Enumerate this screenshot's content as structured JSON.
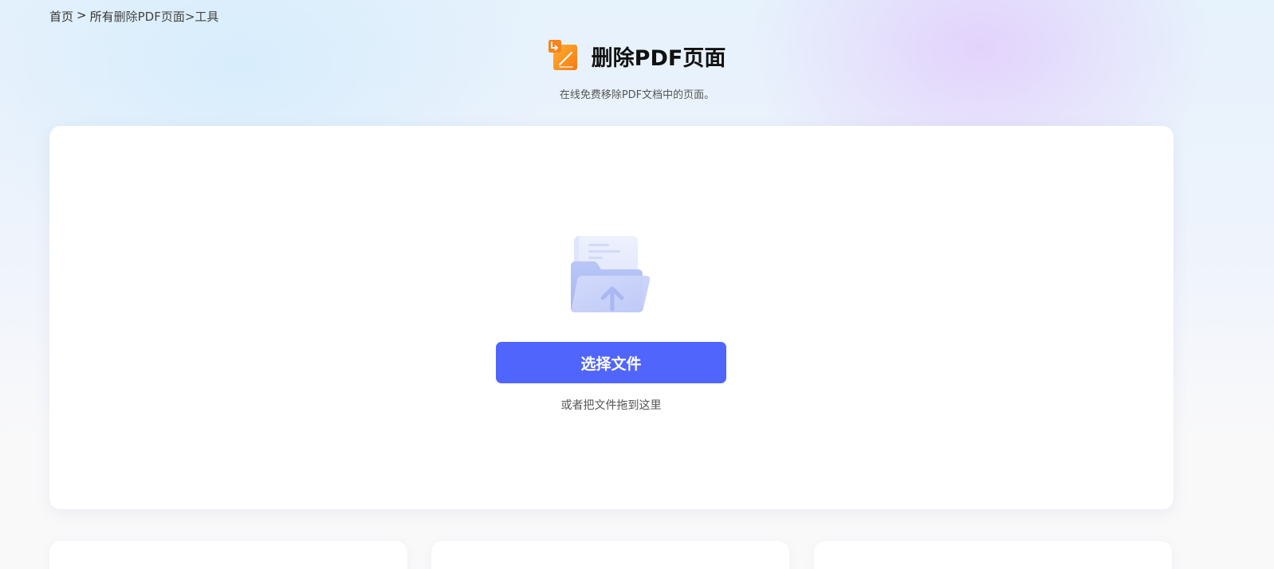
{
  "breadcrumb": {
    "home": "首页",
    "separator": ">",
    "all": "所有",
    "current": "删除PDF页面>工具"
  },
  "header": {
    "title": "删除PDF页面",
    "subtitle": "在线免费移除PDF文档中的页面。",
    "icon": "delete-page-icon"
  },
  "upload": {
    "illustration": "folder-upload-icon",
    "button_label": "选择文件",
    "drag_hint": "或者把文件拖到这里"
  },
  "colors": {
    "accent": "#5065fc",
    "icon_orange": "#f5841f"
  }
}
